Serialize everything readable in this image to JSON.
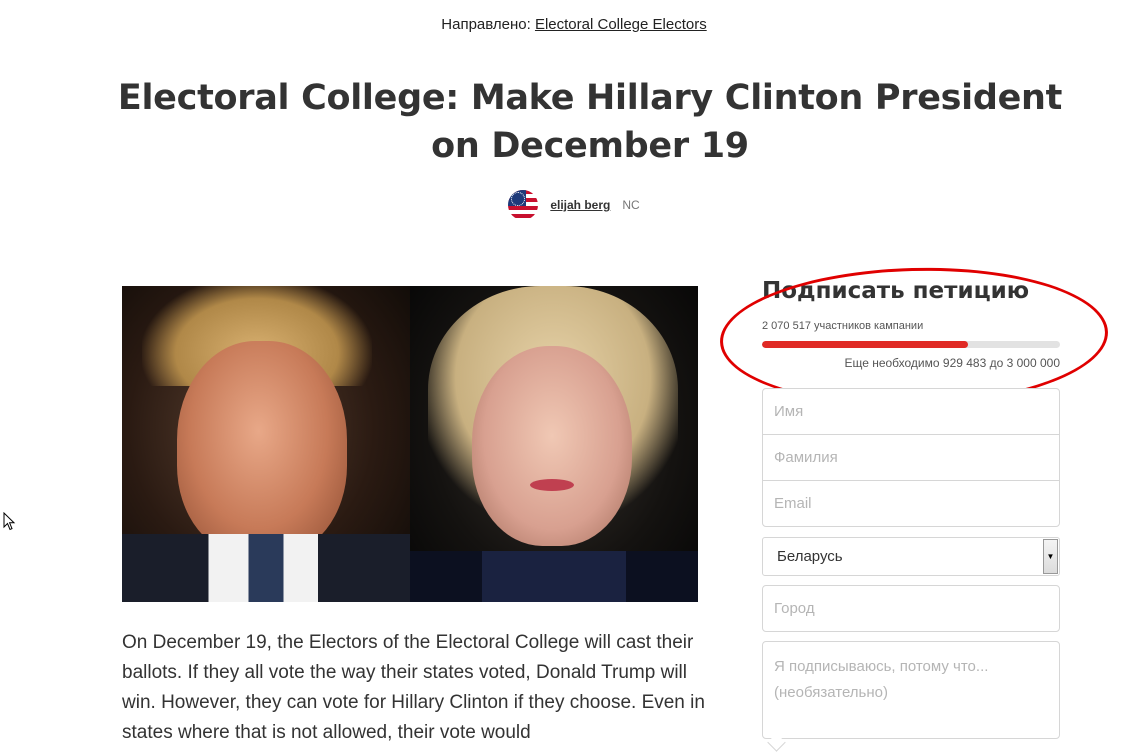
{
  "header": {
    "directed_label": "Направлено:",
    "directed_target": "Electoral College Electors"
  },
  "petition": {
    "title": "Electoral College: Make Hillary Clinton President on December 19",
    "author_name": "elijah berg",
    "author_location": "NC",
    "story": "On December 19, the Electors of the Electoral College will cast their ballots. If they all vote the way their states voted, Donald Trump will win. However, they can vote for Hillary Clinton if they choose. Even in states where that is not allowed, their vote would"
  },
  "sign": {
    "title": "Подписать петицию",
    "supporters_text": "2 070 517 участников кампании",
    "progress": 0.69,
    "progress_color": "#e02a25",
    "remaining_text": "Еще необходимо 929 483 до 3 000 000"
  },
  "form": {
    "first_name_placeholder": "Имя",
    "last_name_placeholder": "Фамилия",
    "email_placeholder": "Email",
    "country_value": "Беларусь",
    "city_placeholder": "Город",
    "reason_placeholder": "Я подписываюсь, потому что... (необязательно)"
  },
  "annotation": {
    "color": "#e00000"
  },
  "icons": {
    "avatar": "us-flag-avatar",
    "select_arrow": "dropdown-arrow-icon",
    "cursor": "mouse-pointer-icon"
  }
}
